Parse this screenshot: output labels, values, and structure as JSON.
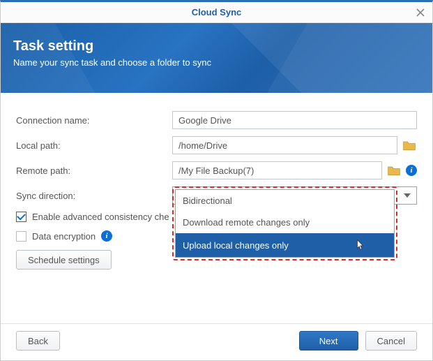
{
  "window_title": "Cloud Sync",
  "header": {
    "title": "Task setting",
    "subtitle": "Name your sync task and choose a folder to sync"
  },
  "form": {
    "connection_name": {
      "label": "Connection name:",
      "value": "Google Drive"
    },
    "local_path": {
      "label": "Local path:",
      "value": "/home/Drive"
    },
    "remote_path": {
      "label": "Remote path:",
      "value": "/My File Backup(7)"
    },
    "sync_direction": {
      "label": "Sync direction:",
      "value": "Bidirectional",
      "options": [
        "Bidirectional",
        "Download remote changes only",
        "Upload local changes only"
      ],
      "highlighted": "Upload local changes only"
    },
    "enable_consistency": {
      "label": "Enable advanced consistency che",
      "checked": true
    },
    "data_encryption": {
      "label": "Data encryption",
      "checked": false
    },
    "schedule_button": "Schedule settings"
  },
  "footer": {
    "back": "Back",
    "next": "Next",
    "cancel": "Cancel"
  }
}
